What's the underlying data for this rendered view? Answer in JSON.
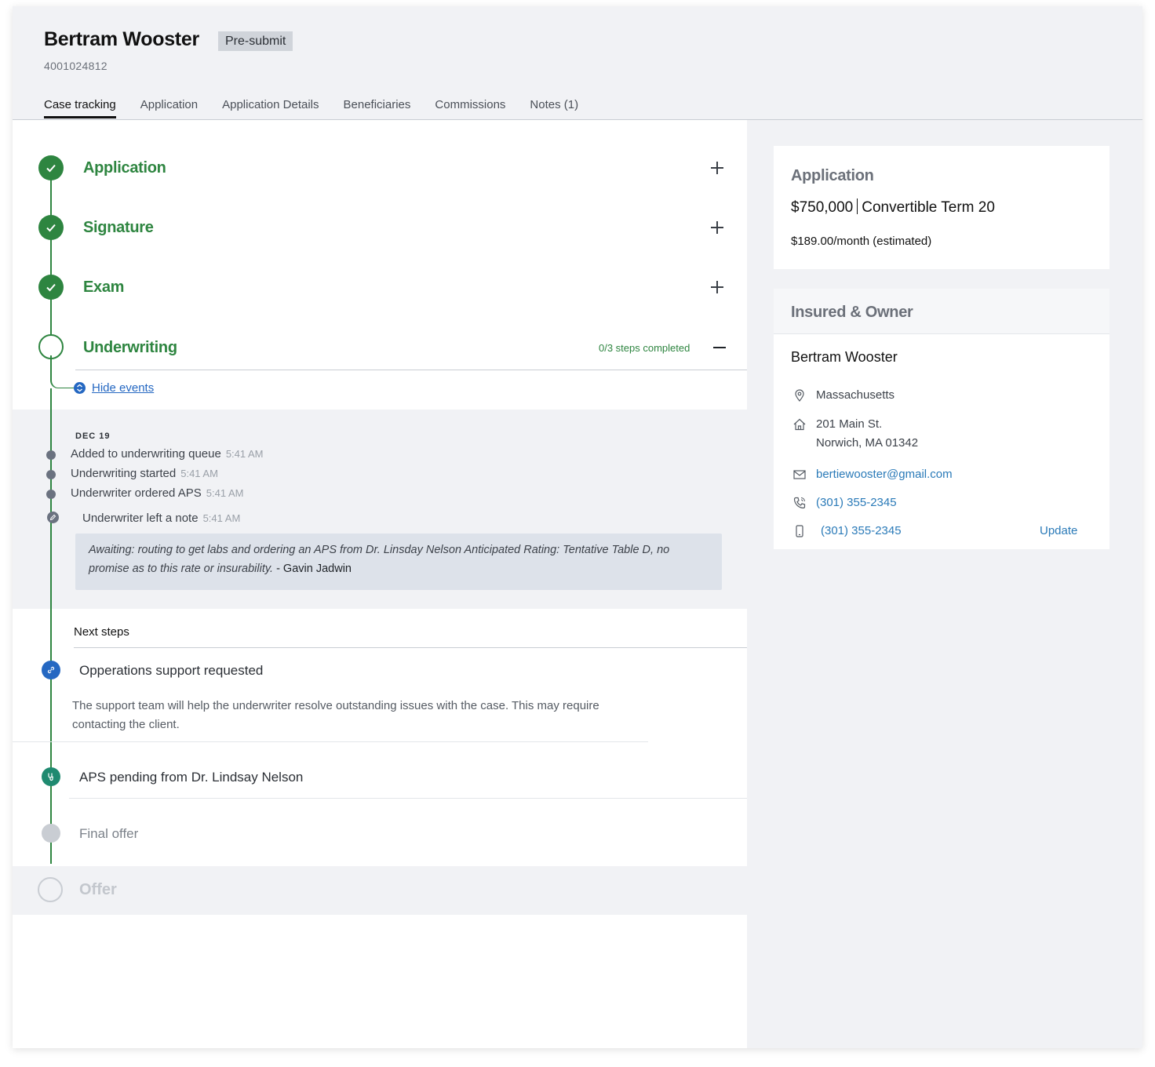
{
  "header": {
    "name": "Bertram Wooster",
    "status_badge": "Pre-submit",
    "case_id": "4001024812"
  },
  "tabs": [
    {
      "label": "Case tracking",
      "active": true
    },
    {
      "label": "Application",
      "active": false
    },
    {
      "label": "Application Details",
      "active": false
    },
    {
      "label": "Beneficiaries",
      "active": false
    },
    {
      "label": "Commissions",
      "active": false
    },
    {
      "label": "Notes (1)",
      "active": false
    }
  ],
  "tracker": {
    "stages": [
      {
        "title": "Application",
        "status": "complete"
      },
      {
        "title": "Signature",
        "status": "complete"
      },
      {
        "title": "Exam",
        "status": "complete"
      },
      {
        "title": "Underwriting",
        "status": "in-progress",
        "progress": "0/3 steps completed"
      },
      {
        "title": "Offer",
        "status": "pending"
      }
    ],
    "hide_events_label": "Hide events",
    "events": {
      "date": "DEC 19",
      "items": [
        {
          "text": "Added to underwriting queue",
          "time": "5:41 AM"
        },
        {
          "text": "Underwriting started",
          "time": "5:41 AM"
        },
        {
          "text": "Underwriter ordered APS",
          "time": "5:41 AM"
        },
        {
          "text": "Underwriter left a note",
          "time": "5:41 AM"
        }
      ],
      "note": "Awaiting: routing to get labs and ordering an APS from Dr. Linsday Nelson Anticipated Rating: Tentative Table D, no promise as to this rate or insurability.",
      "note_author": "- Gavin Jadwin"
    },
    "next_steps_label": "Next steps",
    "next_steps": [
      {
        "title": "Opperations support requested",
        "description": "The support team will help the underwriter resolve outstanding issues with the case. This may require contacting the client."
      },
      {
        "title": "APS pending from Dr. Lindsay Nelson"
      },
      {
        "title": "Final offer"
      }
    ]
  },
  "application_card": {
    "heading": "Application",
    "amount": "$750,000",
    "product": "Convertible Term 20",
    "monthly": "$189.00/month (estimated)"
  },
  "insured_card": {
    "heading": "Insured & Owner",
    "name": "Bertram Wooster",
    "state": "Massachusetts",
    "address_line1": "201 Main St.",
    "address_line2": "Norwich, MA 01342",
    "email": "bertiewooster@gmail.com",
    "phone": "(301) 355-2345",
    "mobile": "(301) 355-2345",
    "update_label": "Update"
  },
  "colors": {
    "success": "#2e8540",
    "link": "#2568c2",
    "panel_bg": "#f1f2f5"
  }
}
